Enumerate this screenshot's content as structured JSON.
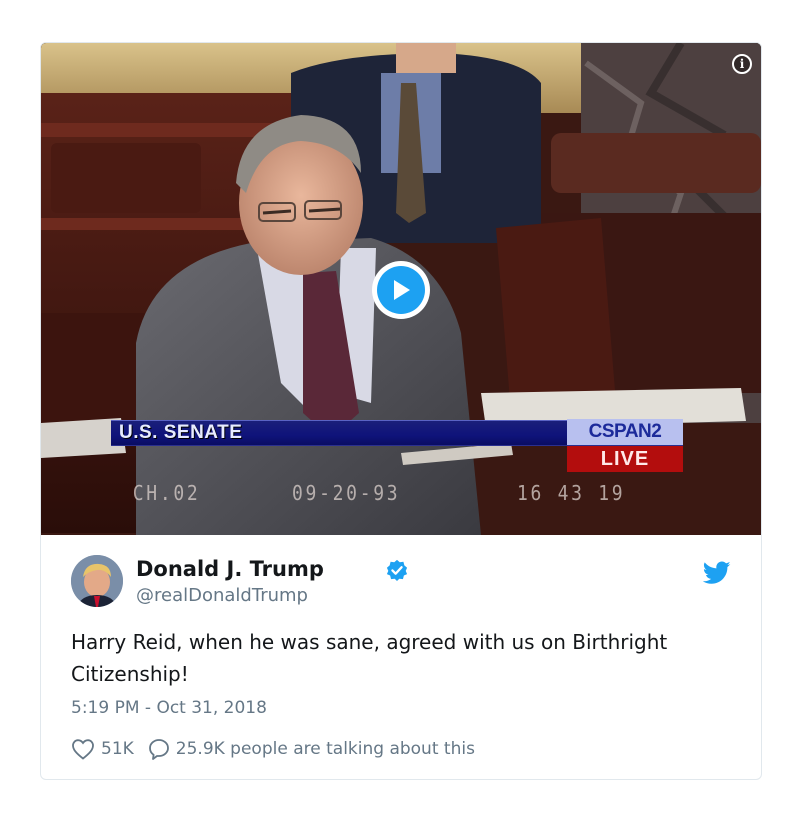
{
  "video": {
    "overlay": {
      "network": "U.S. SENATE",
      "channel_logo": "CSPAN2",
      "live": "LIVE",
      "vhs_channel": "CH.02",
      "vhs_date": "09-20-93",
      "vhs_time": "16 43 19"
    },
    "info_icon": "info-icon",
    "play_icon": "play-icon"
  },
  "tweet": {
    "author_name": "Donald J. Trump",
    "handle": "@realDonaldTrump",
    "text": "Harry Reid, when he was sane, agreed with us on Birthright Citizenship!",
    "timestamp": "5:19 PM - Oct 31, 2018",
    "likes": "51K",
    "replies": "25.9K people are talking about this",
    "brand_icon": "twitter-bird-icon"
  },
  "colors": {
    "twitter_blue": "#1da1f2",
    "text_primary": "#14171a",
    "text_secondary": "#657786",
    "card_border": "#e1e8ed"
  }
}
